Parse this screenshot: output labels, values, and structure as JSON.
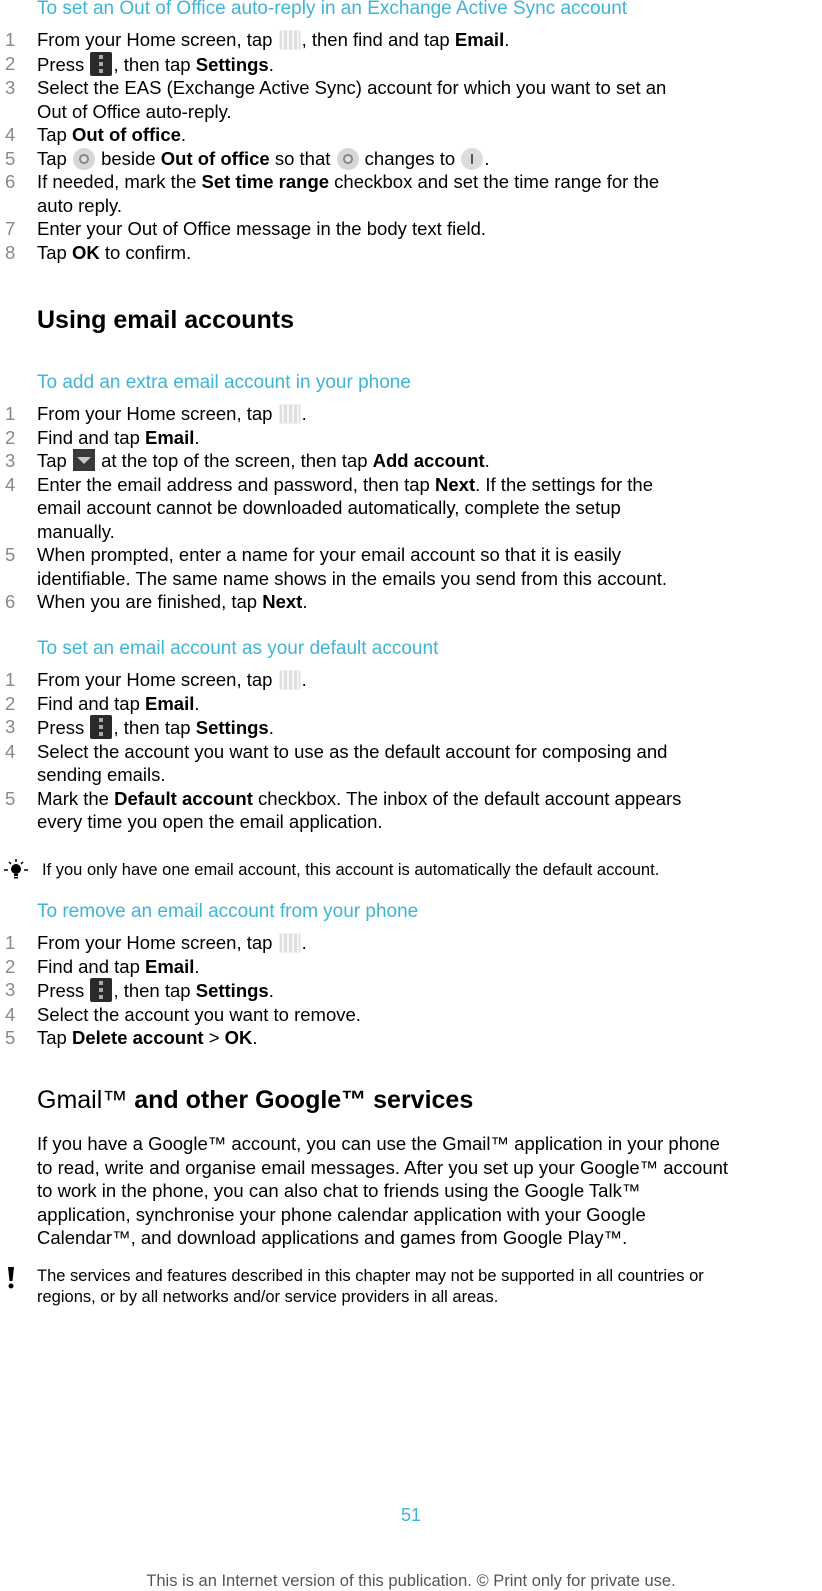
{
  "sections": {
    "out_of_office": {
      "title": "To set an Out of Office auto-reply in an Exchange Active Sync account",
      "steps": [
        {
          "n": "1",
          "a": "From your Home screen, tap ",
          "b": ", then find and tap ",
          "c": "Email",
          "d": "."
        },
        {
          "n": "2",
          "a": "Press ",
          "b": ", then tap ",
          "c": "Settings",
          "d": "."
        },
        {
          "n": "3",
          "l1": "Select the EAS (Exchange Active Sync) account for which you want to set an",
          "l2": "Out of Office auto-reply."
        },
        {
          "n": "4",
          "a": "Tap ",
          "c": "Out of office",
          "d": "."
        },
        {
          "n": "5",
          "a": "Tap ",
          "b": " beside ",
          "c": "Out of office",
          "d": " so that ",
          "e": " changes to ",
          "f": "."
        },
        {
          "n": "6",
          "a": "If needed, mark the ",
          "c": "Set time range",
          "d": " checkbox and set the time range for the",
          "l2": "auto reply."
        },
        {
          "n": "7",
          "a": "Enter your Out of Office message in the body text field."
        },
        {
          "n": "8",
          "a": "Tap ",
          "c": "OK",
          "d": " to confirm."
        }
      ]
    },
    "using_email_accounts": {
      "heading": "Using email accounts"
    },
    "add_account": {
      "title": "To add an extra email account in your phone",
      "steps": [
        {
          "n": "1",
          "a": "From your Home screen, tap ",
          "d": "."
        },
        {
          "n": "2",
          "a": "Find and tap ",
          "c": "Email",
          "d": "."
        },
        {
          "n": "3",
          "a": "Tap ",
          "b": " at the top of the screen, then tap ",
          "c": "Add account",
          "d": "."
        },
        {
          "n": "4",
          "a": "Enter the email address and password, then tap ",
          "c": "Next",
          "d": ". If the settings for the",
          "l2": "email account cannot be downloaded automatically, complete the setup",
          "l3": "manually."
        },
        {
          "n": "5",
          "l1": "When prompted, enter a name for your email account so that it is easily",
          "l2": "identifiable. The same name shows in the emails you send from this account."
        },
        {
          "n": "6",
          "a": "When you are finished, tap ",
          "c": "Next",
          "d": "."
        }
      ]
    },
    "default_account": {
      "title": "To set an email account as your default account",
      "steps": [
        {
          "n": "1",
          "a": "From your Home screen, tap ",
          "d": "."
        },
        {
          "n": "2",
          "a": "Find and tap ",
          "c": "Email",
          "d": "."
        },
        {
          "n": "3",
          "a": "Press ",
          "b": ", then tap ",
          "c": "Settings",
          "d": "."
        },
        {
          "n": "4",
          "l1": "Select the account you want to use as the default account for composing and",
          "l2": "sending emails."
        },
        {
          "n": "5",
          "a": "Mark the ",
          "c": "Default account",
          "d": " checkbox. The inbox of the default account appears",
          "l2": "every time you open the email application."
        }
      ],
      "tip": "If you only have one email account, this account is automatically the default account."
    },
    "remove_account": {
      "title": "To remove an email account from your phone",
      "steps": [
        {
          "n": "1",
          "a": "From your Home screen, tap ",
          "d": "."
        },
        {
          "n": "2",
          "a": "Find and tap ",
          "c": "Email",
          "d": "."
        },
        {
          "n": "3",
          "a": "Press ",
          "b": ", then tap ",
          "c": "Settings",
          "d": "."
        },
        {
          "n": "4",
          "a": "Select the account you want to remove."
        },
        {
          "n": "5",
          "a": "Tap ",
          "c": "Delete account",
          "d": " > ",
          "e": "OK",
          "f": "."
        }
      ]
    },
    "gmail": {
      "heading_norm": "Gmail™",
      "heading_bold": " and other Google™ services",
      "para": [
        "If you have a Google™ account, you can use the Gmail™ application in your phone",
        "to read, write and organise email messages. After you set up your Google™ account",
        "to work in the phone, you can also chat to friends using the Google Talk™",
        "application, synchronise your phone calendar application with your Google",
        "Calendar™, and download applications and games from Google Play™."
      ],
      "warning": [
        "The services and features described in this chapter may not be supported in all countries or",
        "regions, or by all networks and/or service providers in all areas."
      ]
    }
  },
  "footer": {
    "page_number": "51",
    "notice": "This is an Internet version of this publication. © Print only for private use."
  },
  "colors": {
    "accent": "#3eb4d7",
    "step_number": "#888888",
    "text": "#000000"
  },
  "icons": {
    "apps": "apps-grid-icon",
    "menu": "menu-key-icon",
    "toggle_off": "toggle-off-icon",
    "toggle_on": "toggle-on-icon",
    "dropdown": "dropdown-arrow-icon",
    "tip": "lightbulb-icon",
    "warning": "exclamation-icon"
  }
}
